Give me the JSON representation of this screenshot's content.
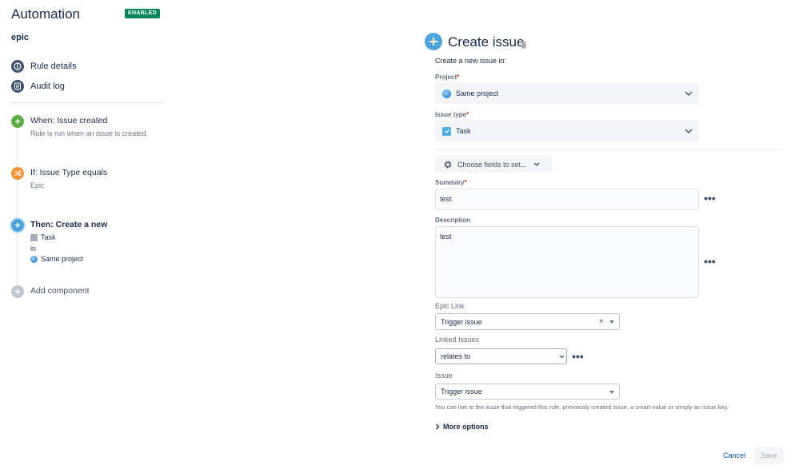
{
  "header": {
    "title": "Automation",
    "status_badge": "ENABLED",
    "rule_name": "epic"
  },
  "nav": {
    "rule_details": "Rule details",
    "audit_log": "Audit log"
  },
  "steps": {
    "trigger": {
      "title": "When: Issue created",
      "subtitle": "Rule is run when an issue is created."
    },
    "condition": {
      "title": "If: Issue Type equals",
      "subtitle": "Epic"
    },
    "action": {
      "title": "Then: Create a new",
      "issue_type": "Task",
      "in_text": "in",
      "project": "Same project"
    },
    "add_component": "Add component"
  },
  "panel": {
    "title": "Create issue",
    "subtitle": "Create a new issue in:",
    "project": {
      "label": "Project",
      "required_mark": "*",
      "value": "Same project"
    },
    "issue_type": {
      "label": "Issue type",
      "required_mark": "*",
      "value": "Task"
    },
    "choose_fields": "Choose fields to set...",
    "summary": {
      "label": "Summary",
      "required_mark": "*",
      "value": "test"
    },
    "description": {
      "label": "Description",
      "value": "test"
    },
    "epic_link": {
      "label": "Epic Link",
      "value": "Trigger issue"
    },
    "linked_issues": {
      "label": "Linked Issues",
      "value": "relates to"
    },
    "issue": {
      "label": "Issue",
      "value": "Trigger issue"
    },
    "help_text": "You can link to the issue that triggered this rule, previously created issue, a smart-value or simply an issue key.",
    "more_options": "More options",
    "cancel": "Cancel",
    "save": "Save"
  },
  "colors": {
    "enabled_badge": "#00875a",
    "trigger_icon": "#5aac44",
    "condition_icon": "#f79233",
    "action_icon": "#4ca3dd",
    "link": "#0052cc",
    "required": "#de350b"
  }
}
